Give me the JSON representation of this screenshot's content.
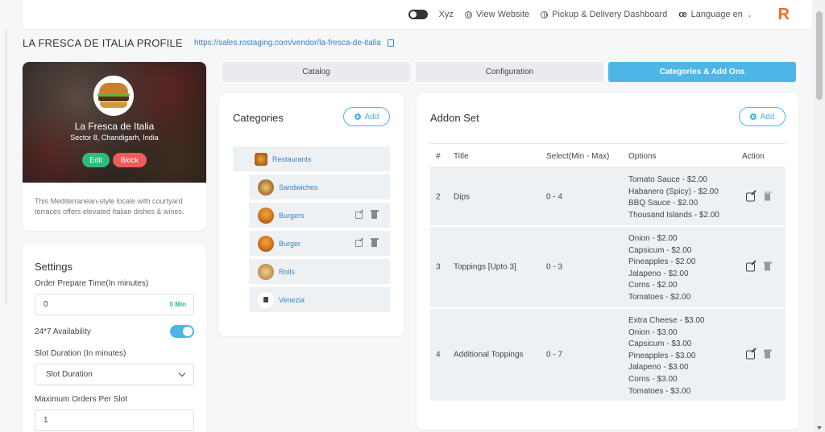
{
  "header": {
    "user_name": "Xyz",
    "view_website": "View Website",
    "dashboard": "Pickup & Delivery Dashboard",
    "language": "Language en",
    "logo": "R"
  },
  "page": {
    "title": "LA FRESCA DE ITALIA PROFILE",
    "url": "https://sales.rostaging.com/vendor/la-fresca-de-italia"
  },
  "profile": {
    "name": "La Fresca de Italia",
    "address": "Sector 8, Chandigarh, India",
    "edit_label": "Edit",
    "block_label": "Block",
    "description": "This Mediterranean-style locale with courtyard terraces offers elevated Italian dishes & wines."
  },
  "settings": {
    "title": "Settings",
    "prep_label": "Order Prepare Time(In minutes)",
    "prep_value": "0",
    "prep_unit": "0 Min",
    "availability_label": "24*7 Availability",
    "availability_on": true,
    "slot_duration_label": "Slot Duration (In minutes)",
    "slot_duration_value": "Slot Duration",
    "max_orders_label": "Maximum Orders Per Slot",
    "max_orders_value": "1"
  },
  "tabs": [
    {
      "label": "Catalog",
      "active": false
    },
    {
      "label": "Configuration",
      "active": false
    },
    {
      "label": "Categories & Add Ons",
      "active": true
    }
  ],
  "categories": {
    "title": "Categories",
    "add_label": "Add",
    "items": [
      {
        "label": "Restaurants",
        "icon": "restaurant-icon",
        "level": 0,
        "actions": false
      },
      {
        "label": "Sandwiches",
        "icon": "sandwich-icon",
        "level": 1,
        "actions": false
      },
      {
        "label": "Burgers",
        "icon": "burger-icon",
        "level": 1,
        "actions": true
      },
      {
        "label": "Burger",
        "icon": "burger-icon",
        "level": 1,
        "actions": true
      },
      {
        "label": "Rolls",
        "icon": "rolls-icon",
        "level": 1,
        "actions": false
      },
      {
        "label": "Venezia",
        "icon": "venezia-icon",
        "level": 1,
        "actions": false
      }
    ]
  },
  "addons": {
    "title": "Addon Set",
    "add_label": "Add",
    "columns": [
      "#",
      "Title",
      "Select(Min - Max)",
      "Options",
      "Action"
    ],
    "rows": [
      {
        "num": "2",
        "title": "Dips",
        "range": "0 - 4",
        "options": [
          "Tomato Sauce - $2.00",
          "Habanero (Spicy) - $2.00",
          "BBQ Sauce - $2.00",
          "Thousand Islands - $2.00"
        ]
      },
      {
        "num": "3",
        "title": "Toppings [Upto 3]",
        "range": "0 - 3",
        "options": [
          "Onion - $2.00",
          "Capsicum - $2.00",
          "Pineapples - $2.00",
          "Jalapeno - $2.00",
          "Corns - $2.00",
          "Tomatoes - $2.00"
        ]
      },
      {
        "num": "4",
        "title": "Additional Toppings",
        "range": "0 - 7",
        "options": [
          "Extra Cheese - $3.00",
          "Onion - $3.00",
          "Capsicum - $3.00",
          "Pineapples - $3.00",
          "Jalapeno - $3.00",
          "Corns - $3.00",
          "Tomatoes - $3.00"
        ]
      }
    ]
  },
  "colors": {
    "accent": "#4db6e6",
    "success": "#2dbd7a",
    "danger": "#ef5a5a",
    "brand": "#f46a27",
    "link": "#3b82c4"
  }
}
